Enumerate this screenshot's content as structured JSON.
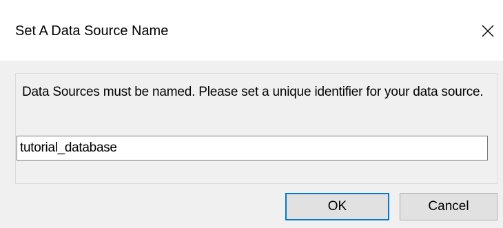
{
  "dialog": {
    "title": "Set A Data Source Name",
    "close_icon": "close-icon",
    "message": "Data Sources must be named.  Please set a unique identifier for your data source.",
    "input": {
      "value": "tutorial_database"
    },
    "buttons": {
      "ok_label": "OK",
      "cancel_label": "Cancel"
    },
    "colors": {
      "default_button_border": "#0078d7",
      "button_face": "#e1e1e1",
      "dialog_background": "#f0f0f0"
    }
  }
}
